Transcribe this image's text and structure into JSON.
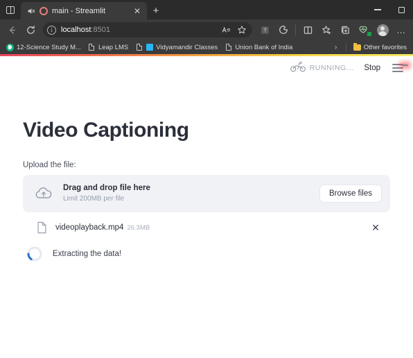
{
  "browser": {
    "tab_search_icon": "tab-search-icon",
    "tab": {
      "mute_icon": "audio-muted-icon",
      "favicon": "streamlit-favicon",
      "title": "main - Streamlit",
      "close_label": "✕"
    },
    "new_tab_label": "+",
    "window_controls": {
      "minimize": "minimize-button",
      "maximize": "maximize-button"
    },
    "nav": {
      "back_label": "←",
      "refresh_label": "↻"
    },
    "omnibox": {
      "info_label": "i",
      "url_host": "localhost",
      "url_port": ":8501",
      "read_aloud_label": "Aᴺ",
      "favorite_label": "☆"
    },
    "toolbar_icons": [
      {
        "name": "help-badge-icon",
        "label": "?"
      },
      {
        "name": "copilot-icon",
        "label": ""
      },
      {
        "name": "split-screen-icon",
        "label": ""
      },
      {
        "name": "favorites-icon",
        "label": ""
      },
      {
        "name": "collections-icon",
        "label": ""
      },
      {
        "name": "browser-essentials-icon",
        "label": ""
      }
    ],
    "profile_name": "profile-avatar",
    "settings_label": "…",
    "bookmarks": [
      {
        "label": "12-Science Study M...",
        "icon": "green-circle-icon"
      },
      {
        "label": "Leap LMS",
        "icon": "page-icon"
      },
      {
        "label": "Vidyamandir Classes",
        "icon": "blue-square-icon"
      },
      {
        "label": "Union Bank of India",
        "icon": "page-icon"
      }
    ],
    "bookmarks_overflow_label": "›",
    "other_favorites": {
      "label": "Other favorites",
      "icon": "folder-icon"
    }
  },
  "app": {
    "status": {
      "running_icon": "bicycle-running-icon",
      "running_text": "RUNNING...",
      "stop_label": "Stop",
      "menu_icon": "hamburger-menu-icon"
    },
    "title": "Video Captioning",
    "upload_label": "Upload the file:",
    "dropzone": {
      "icon": "cloud-upload-icon",
      "main_text": "Drag and drop file here",
      "sub_text": "Limit 200MB per file",
      "browse_label": "Browse files"
    },
    "uploaded_file": {
      "icon": "file-icon",
      "name": "videoplayback.mp4",
      "size": "26.3MB",
      "remove_label": "✕"
    },
    "spinner_status": {
      "icon": "loading-spinner",
      "text": "Extracting the data!"
    }
  },
  "colors": {
    "accent_red": "#ff2b2b",
    "dropzone_bg": "#f0f2f6",
    "title_text": "#2b2f3a",
    "spinner_arc": "#2a6fc9",
    "gradient_start": "#e8455f",
    "gradient_end": "#f5ea6a"
  }
}
